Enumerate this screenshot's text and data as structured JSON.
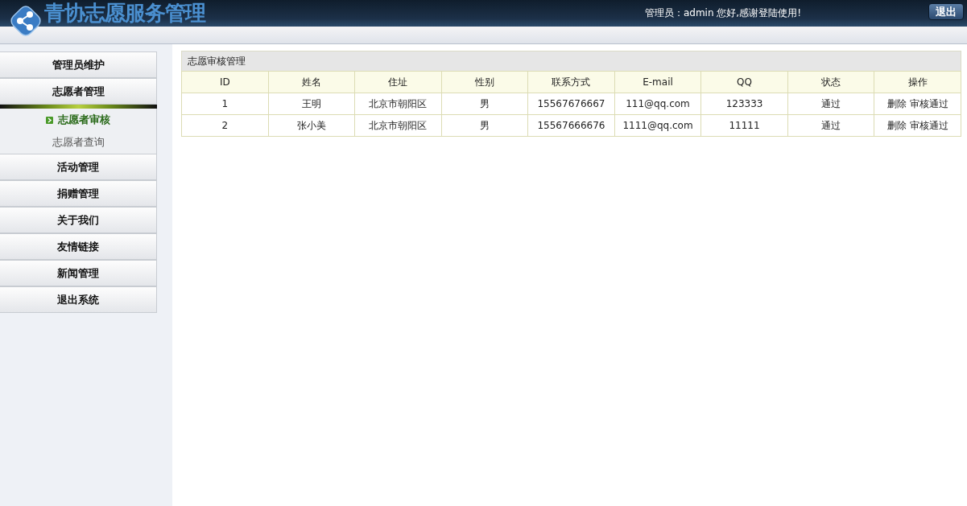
{
  "header": {
    "title": "青协志愿服务管理",
    "greeting": "管理员：admin 您好,感谢登陆使用!",
    "logout_button": "退出"
  },
  "sidebar": {
    "items": [
      {
        "label": "管理员维护",
        "expanded": false
      },
      {
        "label": "志愿者管理",
        "expanded": true,
        "children": [
          {
            "label": "志愿者审核",
            "selected": true
          },
          {
            "label": "志愿者查询",
            "selected": false
          }
        ]
      },
      {
        "label": "活动管理",
        "expanded": false
      },
      {
        "label": "捐赠管理",
        "expanded": false
      },
      {
        "label": "关于我们",
        "expanded": false
      },
      {
        "label": "友情链接",
        "expanded": false
      },
      {
        "label": "新闻管理",
        "expanded": false
      },
      {
        "label": "退出系统",
        "expanded": false
      }
    ]
  },
  "panel": {
    "title": "志愿审核管理",
    "table": {
      "columns": [
        "ID",
        "姓名",
        "住址",
        "性别",
        "联系方式",
        "E-mail",
        "QQ",
        "状态",
        "操作"
      ],
      "rows": [
        {
          "cells": [
            "1",
            "王明",
            "北京市朝阳区",
            "男",
            "15567676667",
            "111@qq.com",
            "123333",
            "通过"
          ],
          "actions": [
            "删除",
            "审核通过"
          ]
        },
        {
          "cells": [
            "2",
            "张小美",
            "北京市朝阳区",
            "男",
            "15567666676",
            "1111@qq.com",
            "11111",
            "通过"
          ],
          "actions": [
            "删除",
            "审核通过"
          ]
        }
      ]
    }
  }
}
